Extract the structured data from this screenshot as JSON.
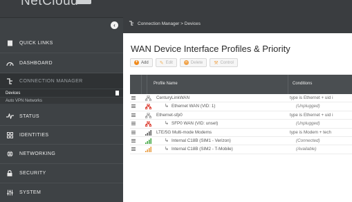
{
  "app": {
    "logo_text": "NetCloud"
  },
  "sidebar": {
    "items": [
      {
        "label": "QUICK LINKS",
        "icon": "quick-links-icon"
      },
      {
        "label": "DASHBOARD",
        "icon": "dashboard-icon"
      },
      {
        "label": "CONNECTION MANAGER",
        "icon": "connection-manager-icon"
      },
      {
        "label": "STATUS",
        "icon": "status-icon"
      },
      {
        "label": "IDENTITIES",
        "icon": "identities-icon"
      },
      {
        "label": "NETWORKING",
        "icon": "networking-icon"
      },
      {
        "label": "SECURITY",
        "icon": "security-icon"
      },
      {
        "label": "SYSTEM",
        "icon": "system-icon"
      }
    ],
    "sub_items": [
      {
        "label": "Devices"
      },
      {
        "label": "Auto VPN Networks"
      }
    ]
  },
  "breadcrumb": {
    "text": "Connection Manager > Devices"
  },
  "page": {
    "title": "WAN Device Interface Profiles & Priority"
  },
  "toolbar": {
    "add_label": "Add",
    "edit_label": "Edit",
    "delete_label": "Delete",
    "control_label": "Control"
  },
  "table": {
    "columns": [
      "Profile Name",
      "Conditions"
    ],
    "rows": [
      {
        "name": "CenturyLinkWAN",
        "condition": "type is Ethernet + uid i",
        "indent": false,
        "device": "ethernet",
        "color": "#9a9a9a",
        "italic": false
      },
      {
        "name": "Ethernet WAN (VID: 1)",
        "condition": "(Unplugged)",
        "indent": true,
        "device": "ethernet",
        "color": "#d9291c",
        "italic": true
      },
      {
        "name": "Ethernet-sfp0",
        "condition": "type is Ethernet + uid i",
        "indent": false,
        "device": "ethernet",
        "color": "#9a9a9a",
        "italic": false
      },
      {
        "name": "SFP0 WAN (VID: unset)",
        "condition": "(Unplugged)",
        "indent": true,
        "device": "ethernet",
        "color": "#d9291c",
        "italic": true
      },
      {
        "name": "LTE/5G Multi-mode Modems",
        "condition": "type is Modem + tech",
        "indent": false,
        "device": "signal",
        "color": "#555555",
        "italic": false
      },
      {
        "name": "Internal C18B (SIM1 - Verizon)",
        "condition": "(Connected)",
        "indent": true,
        "device": "signal",
        "color": "#39a33a",
        "italic": true
      },
      {
        "name": "Internal C18B (SIM2 - T-Mobile)",
        "condition": "(Available)",
        "indent": true,
        "device": "signal",
        "color": "#e89a3c",
        "italic": true
      }
    ]
  },
  "colors": {
    "sidebar_bg": "#3e4245",
    "add_icon": "#f08a1c",
    "delete_icon": "#f08a1c"
  }
}
